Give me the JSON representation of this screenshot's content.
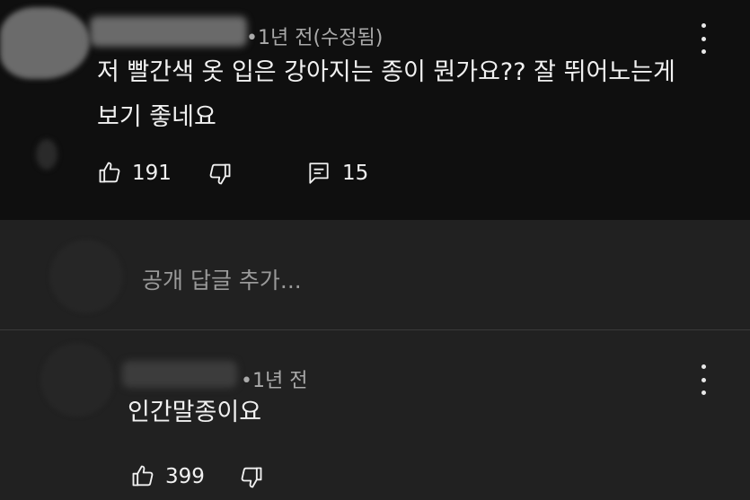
{
  "comment": {
    "meta": "1년 전(수정됨)",
    "text_line1": "저 빨간색 옷 입은 강아지는 종이 뭔가요?? 잘 뛰어노는게",
    "text_line2": "보기 좋네요",
    "likes": "191",
    "replies_count": "15"
  },
  "reply_input": {
    "placeholder": "공개 답글 추가..."
  },
  "reply": {
    "meta": "1년 전",
    "text": "인간말종이요",
    "likes": "399"
  },
  "icons": [
    "like-icon",
    "dislike-icon",
    "reply-icon",
    "more-vert-icon"
  ]
}
